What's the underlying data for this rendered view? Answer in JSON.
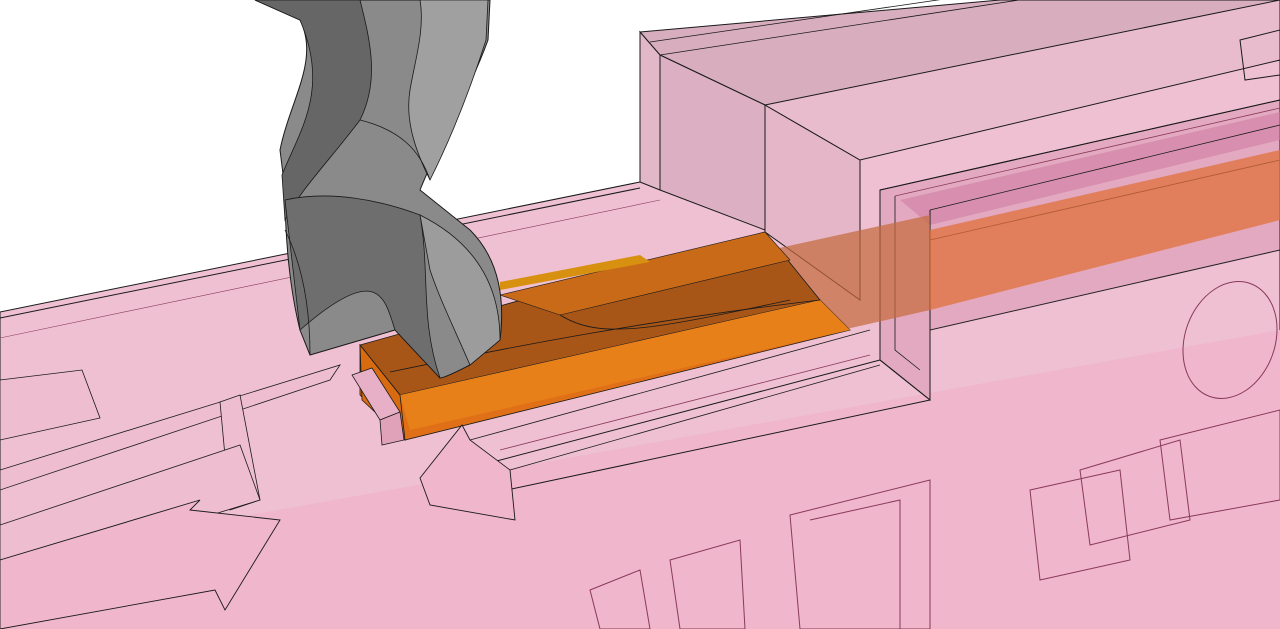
{
  "scene": {
    "background": "#ffffff",
    "colors": {
      "workpiece_fill": "#f0b8cc",
      "workpiece_stroke": "#1a1a1a",
      "workpiece_inner_stroke": "#8a3a5a",
      "toolpath_fill": "#e06a10",
      "toolpath_shadow": "#a85518",
      "toolpath_highlight": "#f08a30",
      "drill_light": "#9a9a9a",
      "drill_mid": "#7a7a7a",
      "drill_dark": "#555555"
    },
    "objects": [
      {
        "name": "workpiece-block",
        "kind": "translucent-pink-solid"
      },
      {
        "name": "raised-block",
        "kind": "translucent-pink-solid"
      },
      {
        "name": "slot-channel",
        "kind": "translucent-pink-solid"
      },
      {
        "name": "toolpath-volume",
        "kind": "orange-material-removal"
      },
      {
        "name": "drill-bit-icon",
        "kind": "twist-drill"
      },
      {
        "name": "arrow-icon",
        "kind": "engraved-arrow"
      },
      {
        "name": "engraved-text",
        "kind": "engraved-outline"
      }
    ]
  }
}
